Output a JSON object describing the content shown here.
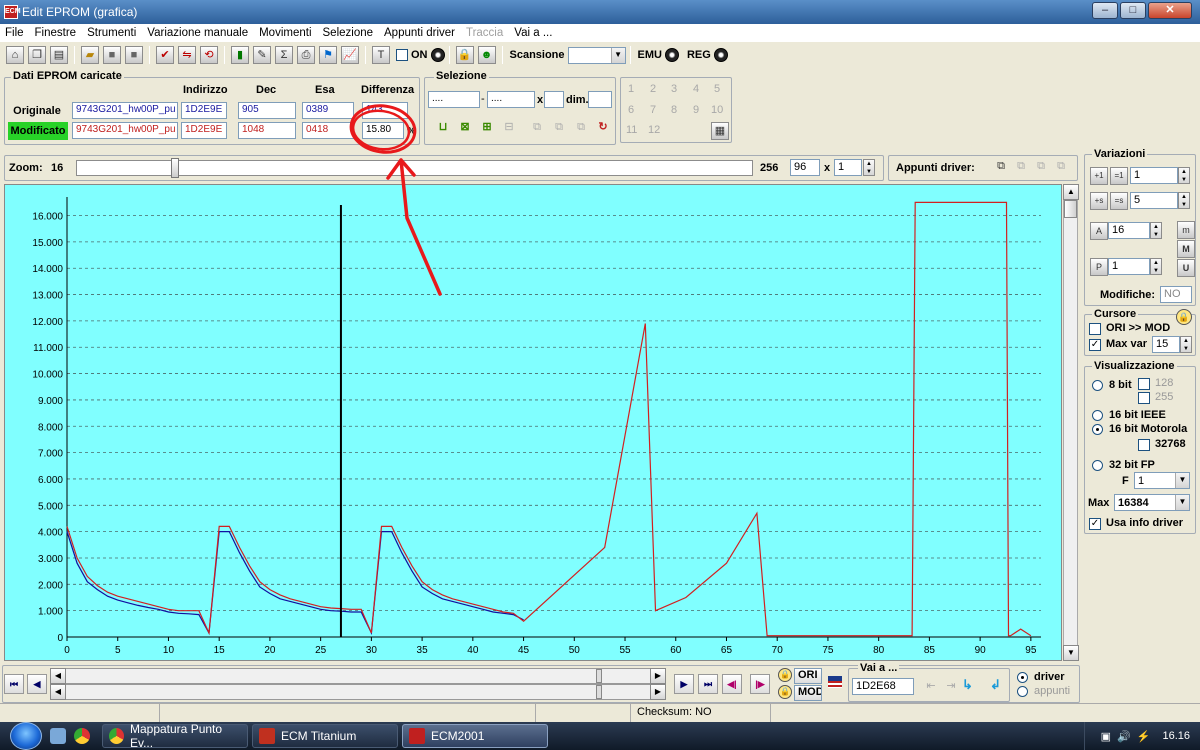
{
  "window": {
    "title": "Edit EPROM (grafica)",
    "app_badge": "ECM"
  },
  "menu": [
    "File",
    "Finestre",
    "Strumenti",
    "Variazione manuale",
    "Movimenti",
    "Selezione",
    "Appunti driver",
    "Traccia",
    "Vai a ..."
  ],
  "menu_disabled": [
    "Traccia"
  ],
  "toolbar": {
    "on_label": "ON",
    "scansione_label": "Scansione",
    "scansione_value": "",
    "emu_label": "EMU",
    "reg_label": "REG"
  },
  "dati": {
    "legend": "Dati EPROM caricate",
    "headers": {
      "indirizzo": "Indirizzo",
      "dec": "Dec",
      "esa": "Esa",
      "differenza": "Differenza"
    },
    "originale": {
      "label": "Originale",
      "file": "9743G201_hw00P_pu",
      "indirizzo": "1D2E9E",
      "dec": "905",
      "esa": "0389",
      "diff": "143"
    },
    "modificato": {
      "label": "Modificato",
      "file": "9743G201_hw00P_pu",
      "indirizzo": "1D2E9E",
      "dec": "1048",
      "esa": "0418",
      "diff": "15.80"
    },
    "percent": "%"
  },
  "selezione": {
    "legend": "Selezione",
    "from": "....",
    "to": "....",
    "x_label": "x",
    "dim_label": "dim.",
    "dim_value": ""
  },
  "numpad": [
    "1",
    "2",
    "3",
    "4",
    "5",
    "6",
    "7",
    "8",
    "9",
    "10",
    "11",
    "12"
  ],
  "zoom": {
    "label": "Zoom:",
    "min": "16",
    "max": "256",
    "value": "96",
    "times": "x",
    "mult": "1",
    "slider_fraction": 0.14
  },
  "appunti_driver_label": "Appunti driver:",
  "variazioni": {
    "legend": "Variazioni",
    "v1": "1",
    "v2": "5",
    "v3": "16",
    "v4": "1",
    "modifiche_label": "Modifiche:",
    "modifiche_value": "NO",
    "btn_m": "m",
    "btn_M": "M",
    "btn_U": "U"
  },
  "cursore": {
    "legend": "Cursore",
    "ori_mod": "ORI >> MOD",
    "ori_mod_checked": false,
    "maxvar_label": "Max var",
    "maxvar_checked": true,
    "maxvar_value": "15"
  },
  "visualizzazione": {
    "legend": "Visualizzazione",
    "bit8": "8 bit",
    "c128": "128",
    "c255": "255",
    "ieee": "16 bit IEEE",
    "motorola": "16 bit Motorola",
    "c32768": "32768",
    "fp32": "32 bit FP",
    "f_label": "F",
    "f_value": "1",
    "max_label": "Max",
    "max_value": "16384",
    "usa_info": "Usa info driver",
    "usa_info_checked": true,
    "selected": "16 bit Motorola"
  },
  "bottom": {
    "ori_label": "ORI",
    "mod_label": "MOD",
    "vai_a_legend": "Vai a ...",
    "vai_a_value": "1D2E68",
    "driver": "driver",
    "appunti": "appunti",
    "selected": "driver"
  },
  "status": {
    "checksum": "Checksum: NO"
  },
  "taskbar": {
    "items": [
      "Mappatura Punto Ev...",
      "ECM Titanium",
      "ECM2001"
    ],
    "active": "ECM2001",
    "clock": "16.16"
  },
  "annotation_color": "#e8191b",
  "chart_data": {
    "type": "line",
    "x_ticks": [
      0,
      5,
      10,
      15,
      20,
      25,
      30,
      35,
      40,
      45,
      50,
      55,
      60,
      65,
      70,
      75,
      80,
      85,
      90,
      95
    ],
    "y_ticks": [
      "0",
      "1.000",
      "2.000",
      "3.000",
      "4.000",
      "5.000",
      "6.000",
      "7.000",
      "8.000",
      "9.000",
      "10.000",
      "11.000",
      "12.000",
      "13.000",
      "14.000",
      "15.000",
      "16.000"
    ],
    "xlim": [
      0,
      96
    ],
    "ylim": [
      0,
      16400
    ],
    "cursor_x": 27,
    "grid": true,
    "colors": {
      "background": "#80ffff",
      "originale": "#1010a0",
      "modificato": "#d22020",
      "cursor": "#000000"
    },
    "series": [
      {
        "key": "originale",
        "x": [
          0,
          1,
          2,
          3,
          4,
          5,
          6,
          7,
          8,
          9,
          10,
          11,
          12,
          13,
          14,
          15,
          16,
          17,
          18,
          19,
          20,
          21,
          22,
          23,
          24,
          25,
          26,
          27,
          28,
          29,
          30,
          31,
          32,
          33,
          34,
          35,
          36,
          37,
          38,
          39,
          40,
          41,
          42,
          43,
          44,
          45
        ],
        "values": [
          4000,
          2800,
          2100,
          1800,
          1550,
          1400,
          1300,
          1200,
          1120,
          1050,
          950,
          900,
          880,
          850,
          150,
          4000,
          4000,
          3200,
          2500,
          1900,
          1650,
          1450,
          1350,
          1250,
          1150,
          1050,
          1000,
          980,
          950,
          950,
          150,
          4000,
          4000,
          3200,
          2500,
          1900,
          1650,
          1450,
          1350,
          1250,
          1150,
          1050,
          950,
          900,
          850,
          650
        ]
      },
      {
        "key": "modificato",
        "x": [
          0,
          1,
          2,
          3,
          4,
          5,
          6,
          7,
          8,
          9,
          10,
          11,
          12,
          13,
          14,
          15,
          16,
          17,
          18,
          19,
          20,
          21,
          22,
          23,
          24,
          25,
          26,
          27,
          28,
          29,
          30,
          31,
          32,
          33,
          34,
          35,
          36,
          37,
          38,
          39,
          40,
          41,
          42,
          43,
          44,
          45,
          53,
          57,
          58,
          61,
          65,
          68,
          69,
          70,
          83,
          83.3,
          83.6,
          92.6,
          92.8,
          93,
          94,
          95
        ],
        "values": [
          4200,
          3000,
          2300,
          1950,
          1700,
          1550,
          1450,
          1350,
          1250,
          1150,
          1050,
          1000,
          1000,
          1000,
          150,
          4200,
          4200,
          3400,
          2700,
          2100,
          1800,
          1600,
          1450,
          1350,
          1250,
          1150,
          1100,
          1080,
          1050,
          1050,
          150,
          4200,
          4200,
          3400,
          2700,
          2100,
          1800,
          1600,
          1450,
          1350,
          1250,
          1150,
          1050,
          950,
          900,
          600,
          3400,
          11900,
          1000,
          1500,
          2800,
          4700,
          50,
          50,
          50,
          50,
          16500,
          16500,
          50,
          50,
          300,
          50
        ]
      }
    ]
  }
}
